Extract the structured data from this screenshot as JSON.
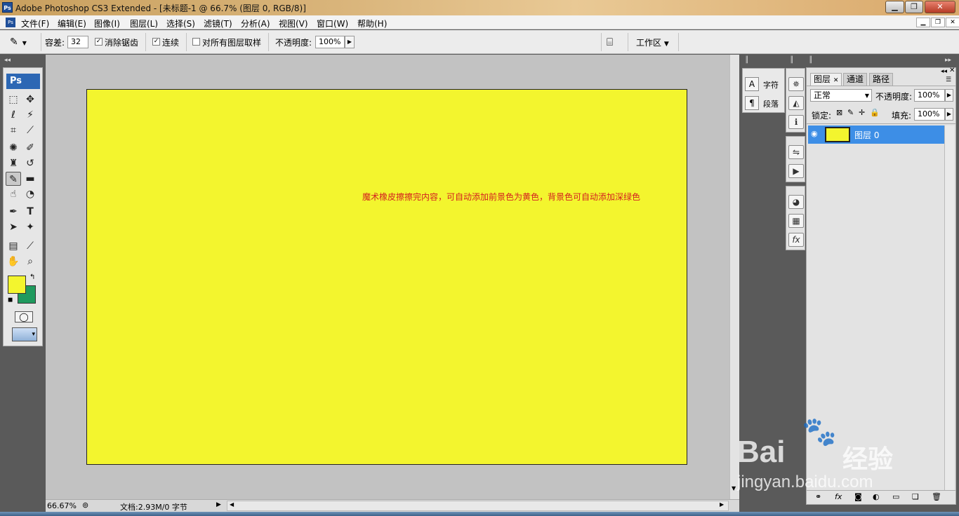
{
  "titlebar": {
    "icon": "Ps",
    "title": "Adobe Photoshop CS3 Extended - [未标题-1 @ 66.7% (图层 0, RGB/8)]",
    "min": "▁",
    "restore": "❐",
    "close": "✕"
  },
  "menu": {
    "icon": "Ps",
    "items": [
      "文件(F)",
      "编辑(E)",
      "图像(I)",
      "图层(L)",
      "选择(S)",
      "滤镜(T)",
      "分析(A)",
      "视图(V)",
      "窗口(W)",
      "帮助(H)"
    ]
  },
  "options": {
    "tolerance_label": "容差:",
    "tolerance_value": "32",
    "antialias_label": "消除锯齿",
    "contiguous_label": "连续",
    "sample_all_label": "对所有图层取样",
    "opacity_label": "不透明度:",
    "opacity_value": "100%",
    "workspace_label": "工作区"
  },
  "toolbox": {
    "logo": "Ps",
    "foreground": "#f3f52e",
    "background": "#1f9a5e"
  },
  "canvas": {
    "annotation": "魔术橡皮擦擦完内容，可自动添加前景色为黄色，背景色可自动添加深绿色",
    "fill": "#f3f52e"
  },
  "status": {
    "zoom": "66.67%",
    "doc_info": "文档:2.93M/0 字节"
  },
  "char_panel": {
    "char": "字符",
    "para": "段落"
  },
  "layers_panel": {
    "tabs": [
      "图层",
      "通道",
      "路径"
    ],
    "blend_mode": "正常",
    "opacity_label": "不透明度:",
    "opacity_value": "100%",
    "lock_label": "锁定:",
    "fill_label": "填充:",
    "fill_value": "100%",
    "layer_name": "图层 0"
  },
  "watermark": {
    "brand": "Bai",
    "brand2": "经验",
    "url": "jingyan.baidu.com"
  }
}
